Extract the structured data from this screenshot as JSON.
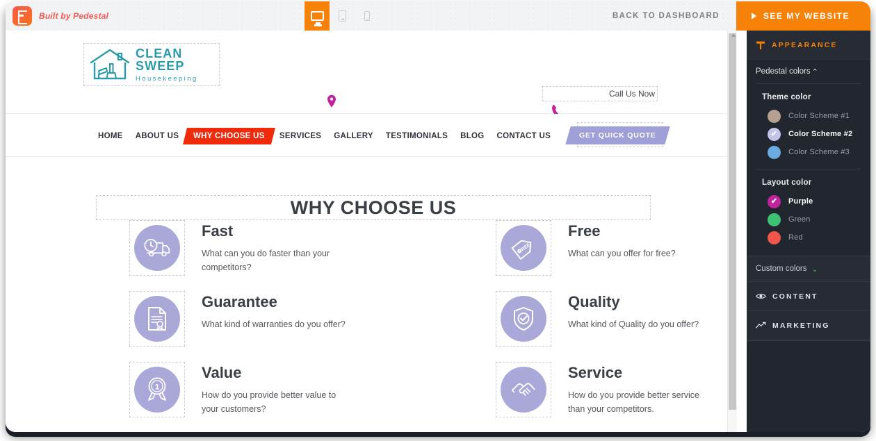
{
  "toolbar": {
    "brand_label": "Built by Pedestal",
    "brand_icon": "pedestal-logo-icon",
    "devices": [
      {
        "name": "desktop",
        "icon": "desktop-icon",
        "active": true
      },
      {
        "name": "tablet",
        "icon": "tablet-icon",
        "active": false
      },
      {
        "name": "mobile",
        "icon": "mobile-icon",
        "active": false
      }
    ],
    "back_to_dashboard": "BACK TO DASHBOARD",
    "see_my_website": "SEE MY WEBSITE",
    "see_my_website_icon": "play-icon",
    "accent_orange": "#f7820a"
  },
  "site": {
    "logo": {
      "icon": "house-broom-icon",
      "title": "CLEAN SWEEP",
      "subtitle": "Housekeeping",
      "color": "#2a9aab"
    },
    "location_icon": "map-pin-icon",
    "phone_icon": "phone-icon",
    "call_us_label": "Call Us Now",
    "accent_magenta": "#c2239e",
    "menu": [
      {
        "label": "HOME",
        "active": false
      },
      {
        "label": "ABOUT US",
        "active": false
      },
      {
        "label": "WHY CHOOSE US",
        "active": true
      },
      {
        "label": "SERVICES",
        "active": false
      },
      {
        "label": "GALLERY",
        "active": false
      },
      {
        "label": "TESTIMONIALS",
        "active": false
      },
      {
        "label": "BLOG",
        "active": false
      },
      {
        "label": "CONTACT US",
        "active": false
      }
    ],
    "active_menu_color": "#f02b0c",
    "quote_button": "GET QUICK QUOTE",
    "quote_button_color": "#9fa0d8",
    "section_title": "WHY CHOOSE US",
    "feature_circle_color": "#aaa8d8",
    "features": [
      {
        "icon": "truck-clock-icon",
        "title": "Fast",
        "desc": "What can you do faster than your competitors?"
      },
      {
        "icon": "free-tag-icon",
        "title": "Free",
        "desc": "What can you offer for free?"
      },
      {
        "icon": "certificate-icon",
        "title": "Guarantee",
        "desc": "What kind of warranties do you offer?"
      },
      {
        "icon": "shield-check-icon",
        "title": "Quality",
        "desc": "What kind of Quality do you offer?"
      },
      {
        "icon": "medal-icon",
        "title": "Value",
        "desc": "How do you provide better value to your customers?"
      },
      {
        "icon": "handshake-icon",
        "title": "Service",
        "desc": "How do you provide better service than your competitors."
      }
    ]
  },
  "sidebar": {
    "panels": [
      {
        "label": "APPEARANCE",
        "icon": "paint-roller-icon",
        "expanded": true
      },
      {
        "label": "CONTENT",
        "icon": "eye-icon",
        "expanded": false
      },
      {
        "label": "MARKETING",
        "icon": "trend-line-icon",
        "expanded": false
      }
    ],
    "pedestal_colors_label": "Pedestal colors",
    "pedestal_colors_chevron": "⌃",
    "theme_color_label": "Theme color",
    "theme_colors": [
      {
        "label": "Color Scheme #1",
        "color": "#b5a092",
        "selected": false
      },
      {
        "label": "Color Scheme #2",
        "color": "#c5c3e8",
        "selected": true
      },
      {
        "label": "Color Scheme #3",
        "color": "#6aabe0",
        "selected": false
      }
    ],
    "layout_color_label": "Layout color",
    "layout_colors": [
      {
        "label": "Purple",
        "color": "#c2239e",
        "selected": true
      },
      {
        "label": "Green",
        "color": "#3dc472",
        "selected": false
      },
      {
        "label": "Red",
        "color": "#f2564b",
        "selected": false
      }
    ],
    "custom_colors_label": "Custom colors",
    "custom_colors_chevron": "⌄",
    "check_glyph": "✔"
  }
}
